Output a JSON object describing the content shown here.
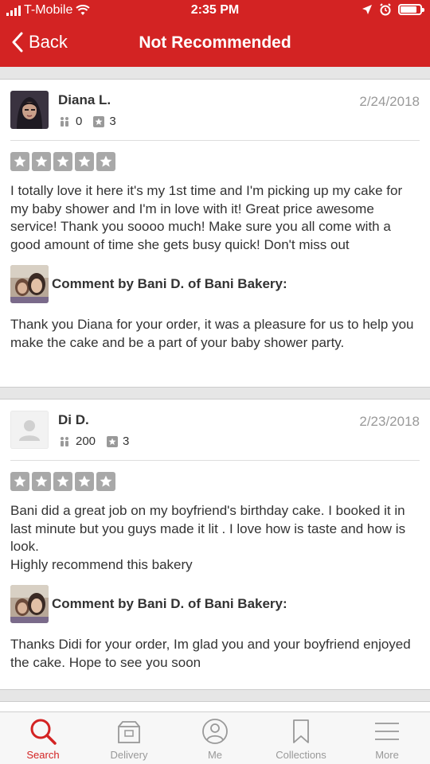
{
  "status_bar": {
    "carrier": "T-Mobile",
    "time": "2:35 PM"
  },
  "nav": {
    "back_label": "Back",
    "title": "Not Recommended"
  },
  "reviews": [
    {
      "user_name": "Diana L.",
      "friends": "0",
      "reviews_count": "3",
      "date": "2/24/2018",
      "rating": 5,
      "text": "I totally love it here it's my 1st time and I'm picking up my cake for my baby shower and I'm in love with it! Great price awesome service! Thank you soooo much! Make sure you all come with a good amount of time she gets busy quick! Don't miss out",
      "comment_title": "Comment by Bani D. of Bani Bakery:",
      "comment_text": "Thank you Diana for your order, it was a pleasure for us to help you make the cake and be a part of your baby shower party."
    },
    {
      "user_name": "Di D.",
      "friends": "200",
      "reviews_count": "3",
      "date": "2/23/2018",
      "rating": 5,
      "text": "Bani did a great job on my boyfriend's birthday cake. I booked it in last minute but you guys made it lit . I love how is taste and how is look.\nHighly recommend this bakery",
      "comment_title": "Comment by Bani D. of Bani Bakery:",
      "comment_text": "Thanks Didi for your order, Im glad you and your boyfriend enjoyed the cake. Hope to see you soon"
    }
  ],
  "tabs": [
    {
      "label": "Search",
      "icon": "search-icon",
      "active": true
    },
    {
      "label": "Delivery",
      "icon": "delivery-bag-icon",
      "active": false
    },
    {
      "label": "Me",
      "icon": "profile-icon",
      "active": false
    },
    {
      "label": "Collections",
      "icon": "bookmark-icon",
      "active": false
    },
    {
      "label": "More",
      "icon": "menu-icon",
      "active": false
    }
  ],
  "colors": {
    "brand_red": "#d32323",
    "star_gray": "#a8a8a8"
  }
}
